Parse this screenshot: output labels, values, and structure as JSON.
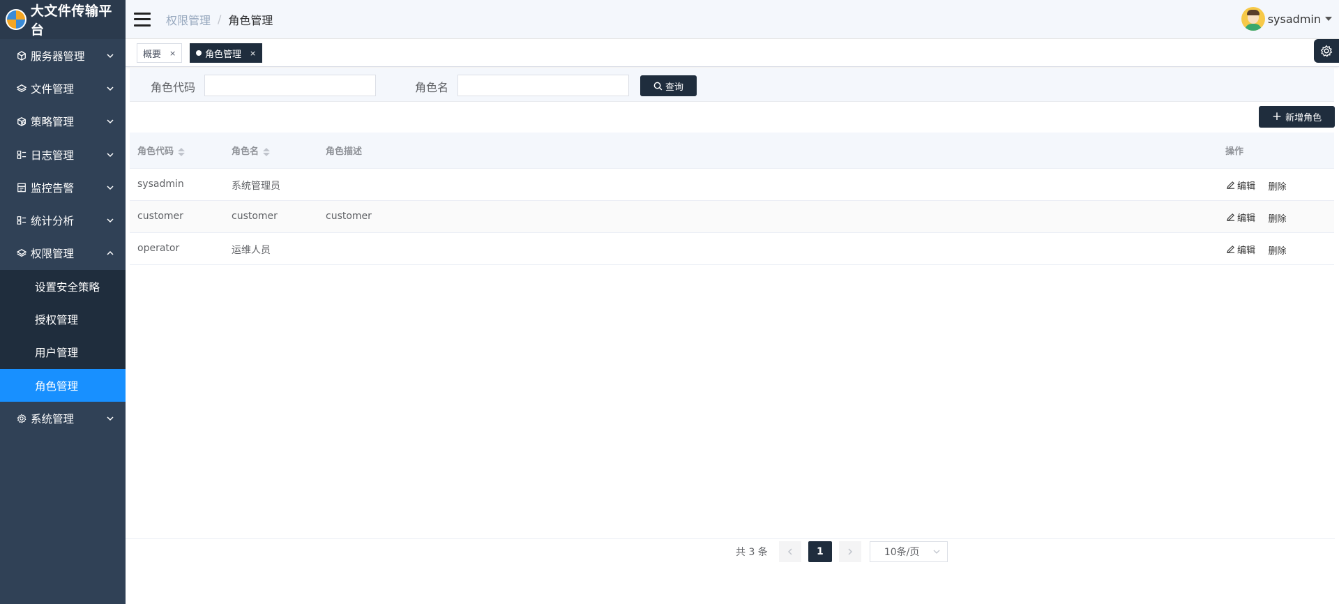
{
  "app": {
    "title": "大文件传输平台"
  },
  "sidebar": {
    "items": [
      {
        "label": "服务器管理",
        "icon": "cube-icon"
      },
      {
        "label": "文件管理",
        "icon": "layers-icon"
      },
      {
        "label": "策略管理",
        "icon": "box-icon"
      },
      {
        "label": "日志管理",
        "icon": "list-icon"
      },
      {
        "label": "监控告警",
        "icon": "monitor-icon"
      },
      {
        "label": "统计分析",
        "icon": "list-icon"
      },
      {
        "label": "权限管理",
        "icon": "layers-icon",
        "expanded": true,
        "children": [
          {
            "label": "设置安全策略"
          },
          {
            "label": "授权管理"
          },
          {
            "label": "用户管理"
          },
          {
            "label": "角色管理",
            "active": true
          }
        ]
      },
      {
        "label": "系统管理",
        "icon": "gear-icon"
      }
    ],
    "colors": {
      "bg": "#304156",
      "active": "#1890ff"
    }
  },
  "header": {
    "breadcrumb": {
      "parent": "权限管理",
      "separator": "/",
      "current": "角色管理"
    },
    "user": {
      "name": "sysadmin"
    }
  },
  "tags": [
    {
      "label": "概要",
      "close": "×"
    },
    {
      "label": "角色管理",
      "close": "×",
      "active": true
    }
  ],
  "search": {
    "role_code_label": "角色代码",
    "role_code_value": "",
    "role_name_label": "角色名",
    "role_name_value": "",
    "query_label": "查询"
  },
  "toolbar": {
    "add_label": "新增角色"
  },
  "table": {
    "columns": {
      "code": "角色代码",
      "name": "角色名",
      "desc": "角色描述",
      "ops": "操作"
    },
    "rows": [
      {
        "code": "sysadmin",
        "name": "系统管理员",
        "desc": "",
        "edit": "编辑",
        "delete": "删除"
      },
      {
        "code": "customer",
        "name": "customer",
        "desc": "customer",
        "edit": "编辑",
        "delete": "删除"
      },
      {
        "code": "operator",
        "name": "运维人员",
        "desc": "",
        "edit": "编辑",
        "delete": "删除"
      }
    ]
  },
  "pagination": {
    "total_text": "共 3 条",
    "current_page": "1",
    "page_size": "10条/页"
  }
}
